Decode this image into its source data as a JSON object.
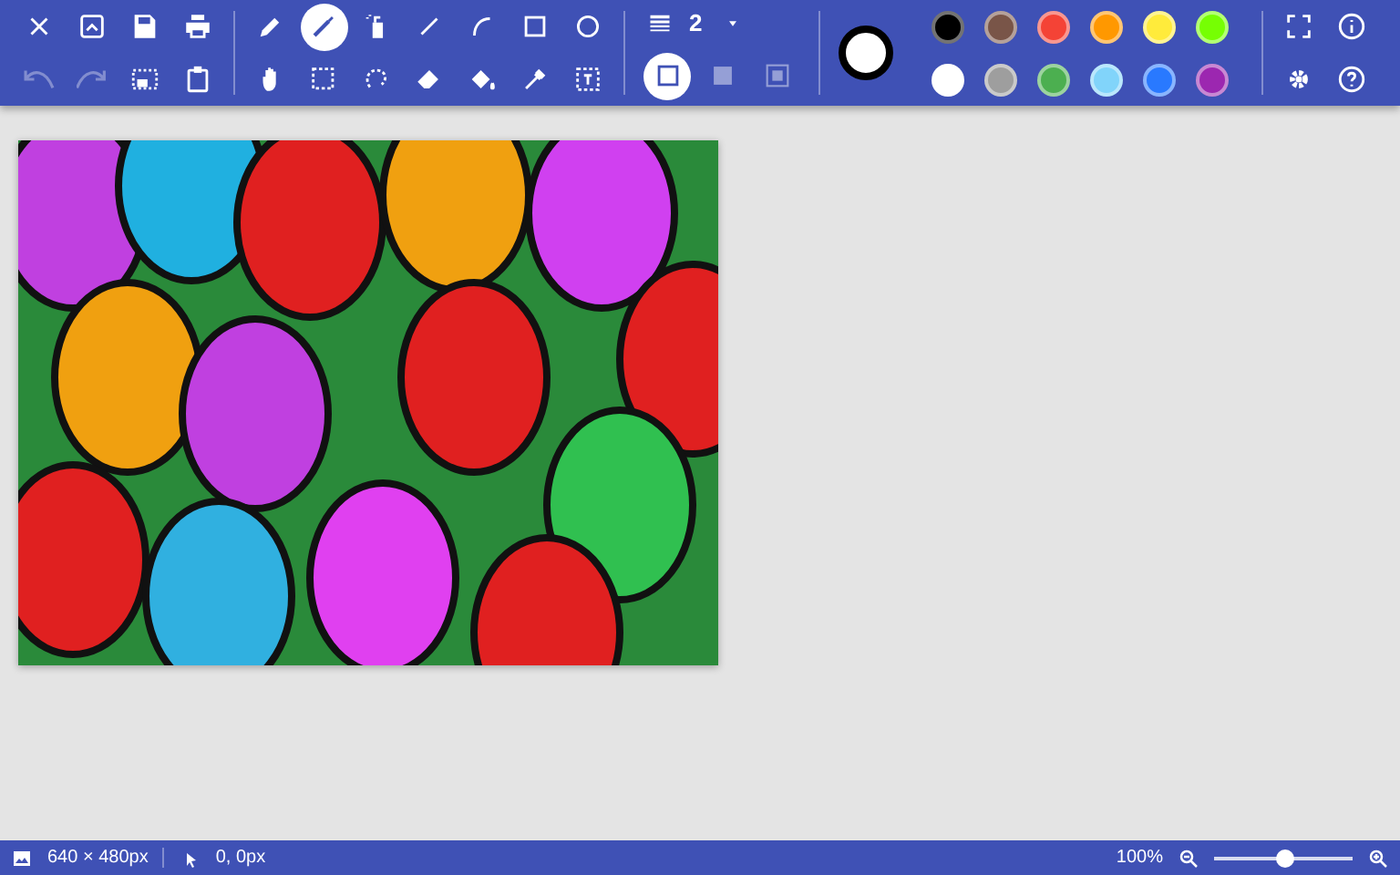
{
  "toolbar": {
    "file_tools": [
      {
        "disabled": false
      },
      {
        "disabled": false
      },
      {
        "disabled": false
      },
      {
        "disabled": false
      },
      {
        "disabled": true
      },
      {
        "disabled": true
      },
      {
        "disabled": false
      },
      {
        "disabled": false
      }
    ],
    "draw_tools": [
      {
        "selected": false
      },
      {
        "selected": true
      },
      {
        "selected": false
      },
      {
        "selected": false
      },
      {
        "selected": false
      },
      {
        "selected": false
      },
      {
        "selected": false
      },
      {
        "selected": false
      },
      {
        "selected": false
      },
      {
        "selected": false
      },
      {
        "selected": false
      },
      {
        "selected": false
      },
      {
        "selected": false
      },
      {
        "selected": false
      }
    ],
    "line_width": {
      "value": "2"
    },
    "fill_styles": [
      {
        "selected": true
      },
      {
        "selected": false
      },
      {
        "selected": false
      }
    ],
    "current_color": {
      "color": "#ffffff"
    },
    "palette": [
      {
        "color": "#000000"
      },
      {
        "color": "#795548"
      },
      {
        "color": "#f44336"
      },
      {
        "color": "#ff9800"
      },
      {
        "color": "#ffeb3b"
      },
      {
        "color": "#76ff03"
      },
      {
        "color": "#ffffff"
      },
      {
        "color": "#9e9e9e"
      },
      {
        "color": "#4caf50"
      },
      {
        "color": "#81d4fa"
      },
      {
        "color": "#2979ff"
      },
      {
        "color": "#9c27b0"
      }
    ]
  },
  "status_bar": {
    "image_size": "640 × 480px",
    "cursor_position": "0, 0px",
    "zoom": {
      "reading": "100%",
      "level": 0.51
    }
  }
}
